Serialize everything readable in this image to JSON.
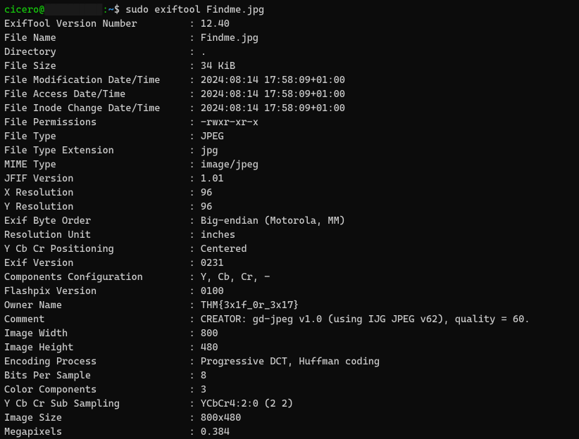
{
  "prompt": {
    "user": "cicero",
    "at": "@",
    "hidden_host": "██████████",
    "separator": ":",
    "path": "~",
    "symbol": "$ ",
    "command": "sudo exiftool Findme.jpg"
  },
  "rows": [
    {
      "label": "ExifTool Version Number",
      "value": "12.40"
    },
    {
      "label": "File Name",
      "value": "Findme.jpg"
    },
    {
      "label": "Directory",
      "value": "."
    },
    {
      "label": "File Size",
      "value": "34 KiB"
    },
    {
      "label": "File Modification Date/Time",
      "value": "2024:08:14 17:58:09+01:00"
    },
    {
      "label": "File Access Date/Time",
      "value": "2024:08:14 17:58:09+01:00"
    },
    {
      "label": "File Inode Change Date/Time",
      "value": "2024:08:14 17:58:09+01:00"
    },
    {
      "label": "File Permissions",
      "value": "-rwxr-xr-x"
    },
    {
      "label": "File Type",
      "value": "JPEG"
    },
    {
      "label": "File Type Extension",
      "value": "jpg"
    },
    {
      "label": "MIME Type",
      "value": "image/jpeg"
    },
    {
      "label": "JFIF Version",
      "value": "1.01"
    },
    {
      "label": "X Resolution",
      "value": "96"
    },
    {
      "label": "Y Resolution",
      "value": "96"
    },
    {
      "label": "Exif Byte Order",
      "value": "Big-endian (Motorola, MM)"
    },
    {
      "label": "Resolution Unit",
      "value": "inches"
    },
    {
      "label": "Y Cb Cr Positioning",
      "value": "Centered"
    },
    {
      "label": "Exif Version",
      "value": "0231"
    },
    {
      "label": "Components Configuration",
      "value": "Y, Cb, Cr, -"
    },
    {
      "label": "Flashpix Version",
      "value": "0100"
    },
    {
      "label": "Owner Name",
      "value": "THM{3x1f_0r_3x17}"
    },
    {
      "label": "Comment",
      "value": "CREATOR: gd-jpeg v1.0 (using IJG JPEG v62), quality = 60."
    },
    {
      "label": "Image Width",
      "value": "800"
    },
    {
      "label": "Image Height",
      "value": "480"
    },
    {
      "label": "Encoding Process",
      "value": "Progressive DCT, Huffman coding"
    },
    {
      "label": "Bits Per Sample",
      "value": "8"
    },
    {
      "label": "Color Components",
      "value": "3"
    },
    {
      "label": "Y Cb Cr Sub Sampling",
      "value": "YCbCr4:2:0 (2 2)"
    },
    {
      "label": "Image Size",
      "value": "800x480"
    },
    {
      "label": "Megapixels",
      "value": "0.384"
    }
  ],
  "label_width": 32
}
